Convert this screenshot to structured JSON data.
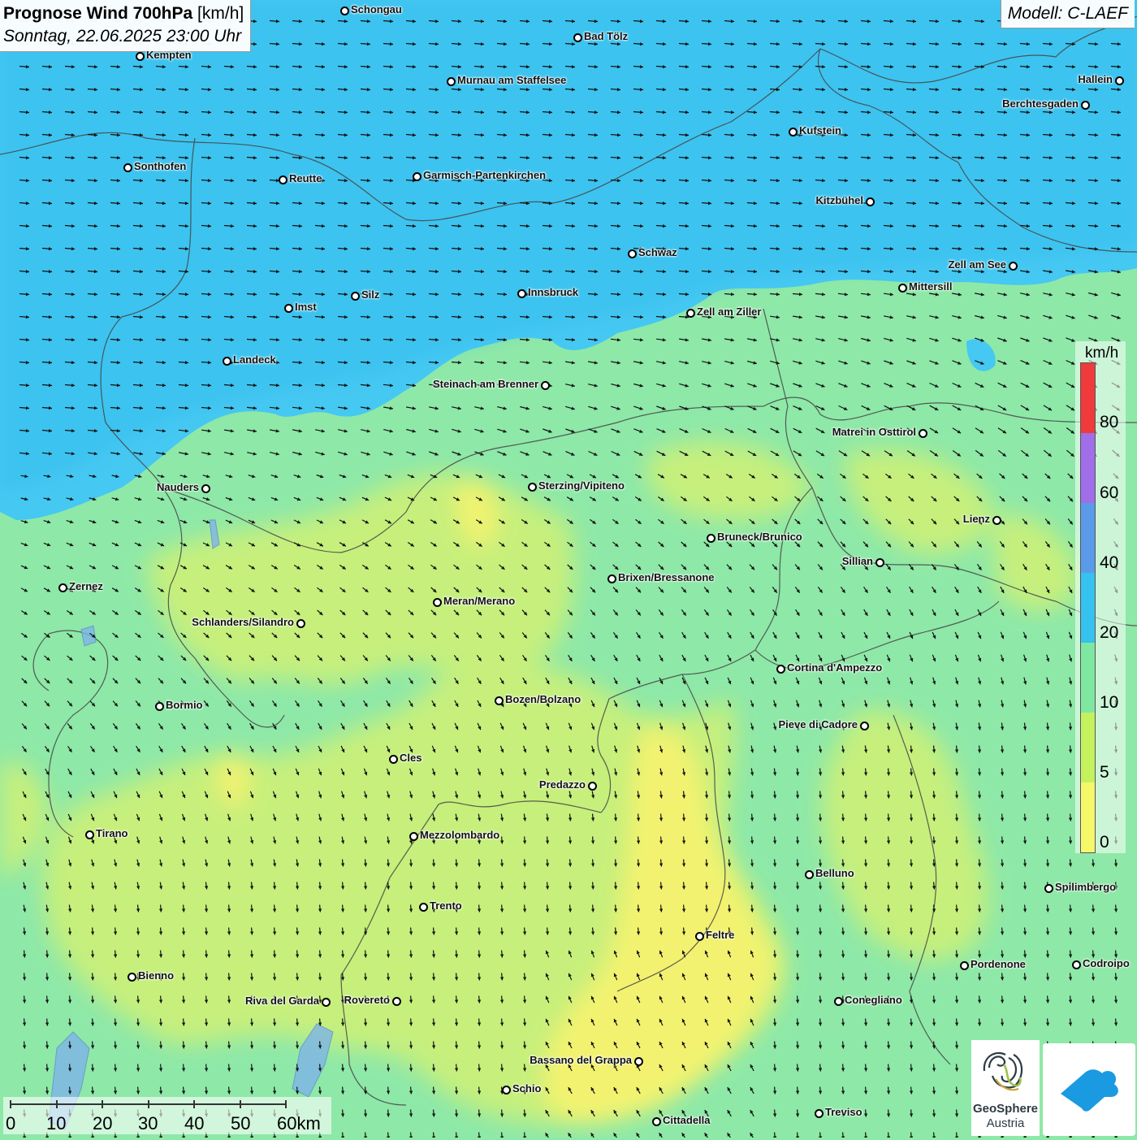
{
  "header": {
    "title_bold": "Prognose Wind 700hPa",
    "title_unit": "[km/h]",
    "subtitle": "Sonntag, 22.06.2025 23:00 Uhr",
    "model": "Modell: C-LAEF"
  },
  "legend": {
    "unit": "km/h",
    "labels": [
      "80",
      "60",
      "40",
      "20",
      "10",
      "5",
      "0"
    ],
    "colors": [
      "#ef3b3b",
      "#9f6ee8",
      "#5b9ae9",
      "#35c2ee",
      "#7ee8a0",
      "#c3f25e",
      "#f7f76a"
    ]
  },
  "scale_bar": {
    "labels": [
      "0",
      "10",
      "20",
      "30",
      "40",
      "50",
      "60km"
    ]
  },
  "branding": {
    "logo_line1": "GeoSphere",
    "logo_line2": "Austria",
    "logo_icon": "geosphere-logo-icon",
    "app_icon": "weather-app-icon"
  },
  "cities": [
    {
      "name": "Schongau"
    },
    {
      "name": "Bad Tölz"
    },
    {
      "name": "Kempten"
    },
    {
      "name": "Murnau am Staffelsee"
    },
    {
      "name": "Hallein"
    },
    {
      "name": "Berchtesgaden"
    },
    {
      "name": "Kufstein"
    },
    {
      "name": "Sonthofen"
    },
    {
      "name": "Reutte"
    },
    {
      "name": "Garmisch-Partenkirchen"
    },
    {
      "name": "Kitzbühel"
    },
    {
      "name": "Schwaz"
    },
    {
      "name": "Zell am See"
    },
    {
      "name": "Mittersill"
    },
    {
      "name": "Innsbruck"
    },
    {
      "name": "Silz"
    },
    {
      "name": "Imst"
    },
    {
      "name": "Zell am Ziller"
    },
    {
      "name": "Landeck"
    },
    {
      "name": "Steinach am Brenner"
    },
    {
      "name": "Matrei in Osttirol"
    },
    {
      "name": "Nauders"
    },
    {
      "name": "Sterzing/Vipiteno"
    },
    {
      "name": "Lienz"
    },
    {
      "name": "Bruneck/Brunico"
    },
    {
      "name": "Sillian"
    },
    {
      "name": "Zernez"
    },
    {
      "name": "Brixen/Bressanone"
    },
    {
      "name": "Meran/Merano"
    },
    {
      "name": "Schlanders/Silandro"
    },
    {
      "name": "Cortina d'Ampezzo"
    },
    {
      "name": "Bozen/Bolzano"
    },
    {
      "name": "Bormio"
    },
    {
      "name": "Pieve di Cadore"
    },
    {
      "name": "Cles"
    },
    {
      "name": "Predazzo"
    },
    {
      "name": "Tirano"
    },
    {
      "name": "Mezzolombardo"
    },
    {
      "name": "Belluno"
    },
    {
      "name": "Spilimbergo"
    },
    {
      "name": "Trento"
    },
    {
      "name": "Feltre"
    },
    {
      "name": "Pordenone"
    },
    {
      "name": "Codroipo"
    },
    {
      "name": "Bienno"
    },
    {
      "name": "Riva del Garda"
    },
    {
      "name": "Rovereto"
    },
    {
      "name": "Conegliano"
    },
    {
      "name": "Bassano del Grappa"
    },
    {
      "name": "Schio"
    },
    {
      "name": "Treviso"
    },
    {
      "name": "Cittadella"
    }
  ]
}
